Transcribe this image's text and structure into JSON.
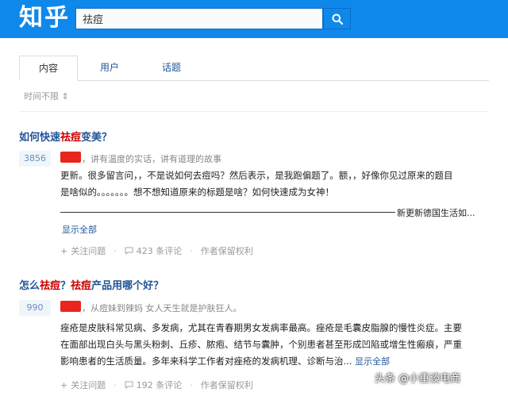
{
  "header": {
    "logo": "知乎",
    "search_value": "祛痘",
    "brand_color": "#0f88eb"
  },
  "tabs": [
    {
      "label": "内容",
      "active": true
    },
    {
      "label": "用户",
      "active": false
    },
    {
      "label": "话题",
      "active": false
    }
  ],
  "filter": {
    "label": "时间不限 ⇕"
  },
  "results": [
    {
      "title_parts": [
        "如何快速",
        "祛痘",
        "变美？"
      ],
      "votes": "3856",
      "author_bio": "，讲有温度的实话，讲有道理的故事",
      "body_line1": "更新。很多留言问，，不是说如何去痘吗？然后表示，是我跑偏题了。额，，好像你见过原来的题目",
      "body_line2": "是啥似的。。。。。。。想不想知道原来的标题是啥？如何快速成为女神！",
      "trail_text": "新更新德国生活如...",
      "show_all": "显示全部",
      "follow": "关注问题",
      "comments": "423 条评论",
      "rights": "作者保留权利"
    },
    {
      "title_parts": [
        "怎么",
        "祛痘",
        "？",
        "祛痘",
        "产品用哪个好？"
      ],
      "votes": "990",
      "author_bio": "，从痘妹到辣妈 女人天生就是护肤狂人。",
      "body_line1": "痤疮是皮肤科常见病、多发病，尤其在青春期男女发病率最高。痤疮是毛囊皮脂腺的慢性炎症。主要",
      "body_line2": "在面部出现白头与黑头粉刺、丘疹、脓疱、结节与囊肿，个别患者甚至形成凹陷或增生性瘢痕，严重",
      "body_line3": "影响患者的生活质量。多年来科学工作者对痤疮的发病机理、诊断与治...",
      "show_all": "显示全部",
      "follow": "关注问题",
      "comments": "192 条评论",
      "rights": "作者保留权利"
    }
  ],
  "watermark": {
    "text": "头条 @小重谈电商"
  }
}
